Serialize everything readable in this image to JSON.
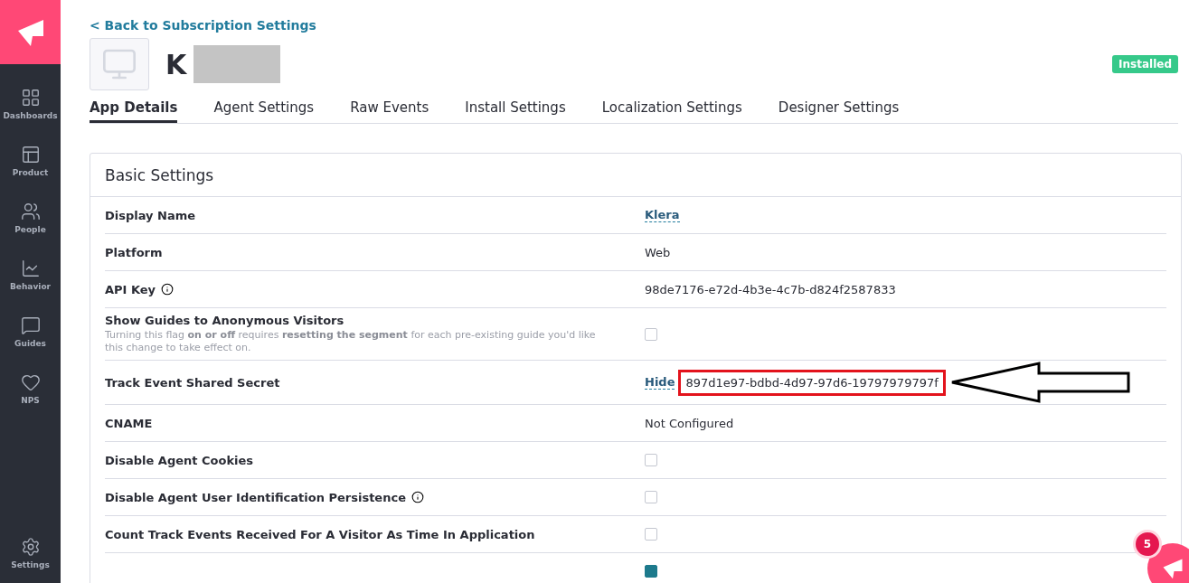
{
  "sidebar": {
    "items": [
      {
        "kind": "dashboards",
        "label": "Dashboards",
        "selected": false
      },
      {
        "kind": "product",
        "label": "Product",
        "selected": false
      },
      {
        "kind": "people",
        "label": "People",
        "selected": false
      },
      {
        "kind": "behavior",
        "label": "Behavior",
        "selected": false
      },
      {
        "kind": "guides",
        "label": "Guides",
        "selected": false
      },
      {
        "kind": "nps",
        "label": "NPS",
        "selected": false
      }
    ],
    "footer": {
      "kind": "settings",
      "label": "Settings",
      "selected": false
    }
  },
  "back_link": "< Back to Subscription Settings",
  "app": {
    "name": "K",
    "redacted": true,
    "status": "Installed"
  },
  "tabs": [
    {
      "label": "App Details",
      "selected": true
    },
    {
      "label": "Agent Settings",
      "selected": false
    },
    {
      "label": "Raw Events",
      "selected": false
    },
    {
      "label": "Install Settings",
      "selected": false
    },
    {
      "label": "Localization Settings",
      "selected": false
    },
    {
      "label": "Designer Settings",
      "selected": false
    }
  ],
  "panel": {
    "title": "Basic Settings",
    "rows": [
      {
        "kind": "link",
        "label": "Display Name",
        "value": "Klera"
      },
      {
        "kind": "text",
        "label": "Platform",
        "value": "Web"
      },
      {
        "kind": "text",
        "label": "API Key",
        "info": true,
        "value": "98de7176-e72d-4b3e-4c7b-d824f2587833"
      },
      {
        "kind": "checkbox",
        "label": "Show Guides to Anonymous Visitors",
        "note": "Turning this flag **on or off** requires **resetting the segment** for each pre-existing guide you'd like this change to take effect on.",
        "checked": false
      },
      {
        "kind": "secret",
        "label": "Track Event Shared Secret",
        "action": "Hide",
        "value": "897d1e97-bdbd-4d97-97d6-19797979797f",
        "highlighted": true
      },
      {
        "kind": "text",
        "label": "CNAME",
        "value": "Not Configured"
      },
      {
        "kind": "checkbox",
        "label": "Disable Agent Cookies",
        "checked": false
      },
      {
        "kind": "checkbox",
        "label": "Disable Agent User Identification Persistence",
        "info": true,
        "checked": false
      },
      {
        "kind": "checkbox",
        "label": "Count Track Events Received For A Visitor As Time In Application",
        "checked": false
      },
      {
        "kind": "checkbox",
        "checked": true
      }
    ]
  },
  "help_launcher": {
    "count": "5"
  }
}
